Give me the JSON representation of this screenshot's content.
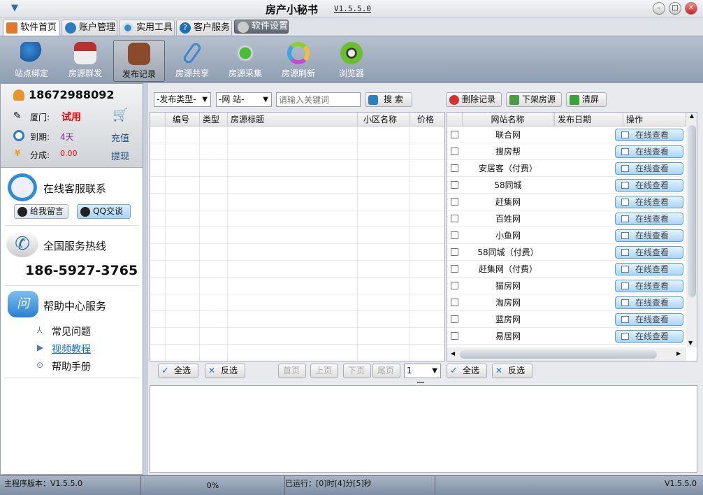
{
  "window": {
    "title": "房产小秘书",
    "version": "V1.5.5.0"
  },
  "tabs": [
    "软件首页",
    "账户管理",
    "实用工具",
    "客户服务",
    "软件设置"
  ],
  "toolbar": [
    "站点绑定",
    "房源群发",
    "发布记录",
    "房源共享",
    "房源采集",
    "房源刷新",
    "浏览器"
  ],
  "account": {
    "phone": "18672988092",
    "city_label": "厦门:",
    "city_status": "试用",
    "expire_label": "到期:",
    "expire_value": "4天",
    "share_label": "分成:",
    "share_value": "0.00",
    "recharge": "充值",
    "withdraw": "提现"
  },
  "support": {
    "online_title": "在线客服联系",
    "leave_msg": "给我留言",
    "qq_chat": "QQ交谈",
    "hotline_title": "全国服务热线",
    "hotline": "186-5927-3765",
    "help_title": "帮助中心服务",
    "help_links": [
      "常见问题",
      "视频教程",
      "帮助手册"
    ]
  },
  "filters": {
    "type": "-发布类型-",
    "site": "-网  站-",
    "keyword_placeholder": "请输入关键词",
    "search": "搜 索",
    "delete": "删除记录",
    "offline": "下架房源",
    "clear": "清屏"
  },
  "left_grid": {
    "columns": [
      "编号",
      "类型",
      "房源标题",
      "小区名称",
      "价格"
    ]
  },
  "right_grid": {
    "columns": [
      "网站名称",
      "发布日期",
      "操作"
    ],
    "action_label": "在线查看",
    "sites": [
      "联合网",
      "搜房帮",
      "安居客（付费）",
      "58同城",
      "赶集网",
      "百姓网",
      "小鱼网",
      "58同城（付费）",
      "赶集网（付费）",
      "猫房网",
      "淘房网",
      "蓝房网",
      "易居网"
    ]
  },
  "pager": {
    "select_all": "全选",
    "invert": "反选",
    "first": "首页",
    "prev": "上页",
    "next": "下页",
    "last": "尾页",
    "page": "1"
  },
  "status": {
    "main_version": "主程序版本：V1.5.5.0",
    "progress": "0%",
    "runtime": "已运行：[0]时[4]分[5]秒",
    "version": "V1.5.5.0"
  }
}
